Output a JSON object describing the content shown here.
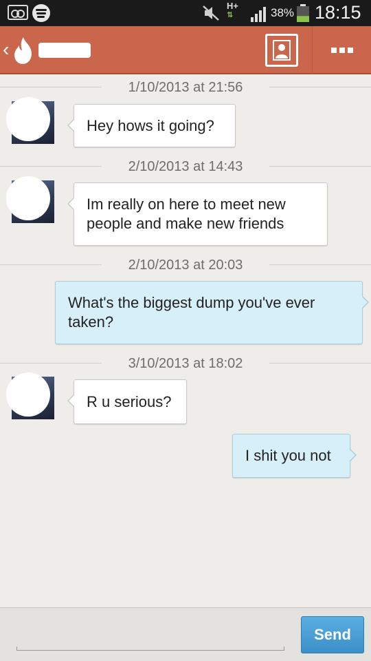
{
  "status_bar": {
    "network": "H+",
    "battery_percent": "38%",
    "battery_level": 0.38,
    "time": "18:15",
    "icons": [
      "voicemail-icon",
      "spotify-icon",
      "mute-icon",
      "signal-icon",
      "battery-icon"
    ]
  },
  "header": {
    "contact_name": "",
    "background_color": "#c9664b"
  },
  "conversation": {
    "timestamps": [
      "1/10/2013 at 21:56",
      "2/10/2013 at 14:43",
      "2/10/2013 at 20:03",
      "3/10/2013 at 18:02"
    ],
    "messages": [
      {
        "direction": "in",
        "text": "Hey hows it going?"
      },
      {
        "direction": "in",
        "text": "Im really on here to meet new people and make new friends"
      },
      {
        "direction": "out",
        "text": "What's the biggest dump you've ever taken?"
      },
      {
        "direction": "in",
        "text": "R u serious?"
      },
      {
        "direction": "out",
        "text": "I shit you not"
      }
    ]
  },
  "compose": {
    "input_value": "",
    "send_label": "Send",
    "send_color": "#3a8fc8"
  }
}
